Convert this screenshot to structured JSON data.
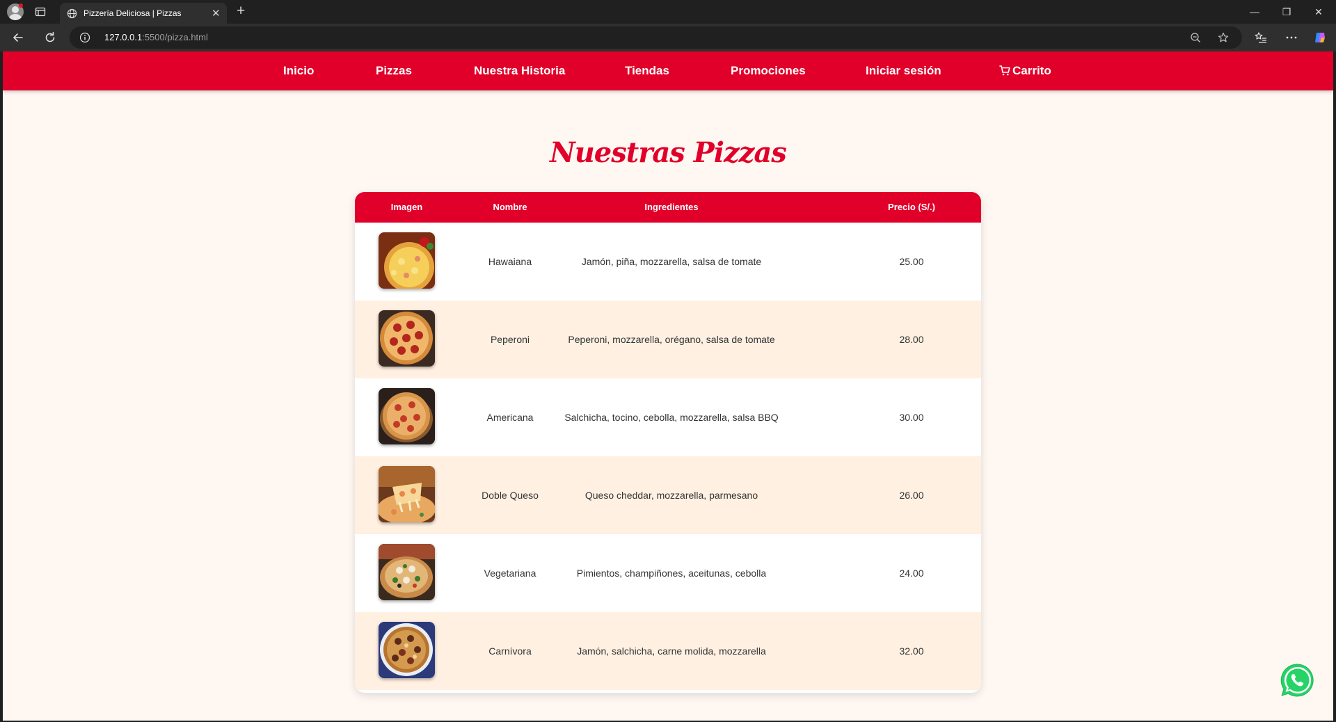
{
  "browser": {
    "tab_title": "Pizzería Deliciosa | Pizzas",
    "url_host": "127.0.0.1",
    "url_path": ":5500/pizza.html"
  },
  "nav": {
    "items": [
      {
        "label": "Inicio"
      },
      {
        "label": "Pizzas"
      },
      {
        "label": "Nuestra Historia"
      },
      {
        "label": "Tiendas"
      },
      {
        "label": "Promociones"
      },
      {
        "label": "Iniciar sesión"
      },
      {
        "label": "Carrito"
      }
    ]
  },
  "page": {
    "title": "Nuestras Pizzas"
  },
  "table": {
    "headers": [
      "Imagen",
      "Nombre",
      "Ingredientes",
      "Precio (S/.)"
    ],
    "rows": [
      {
        "name": "Hawaiana",
        "ingredients": "Jamón, piña, mozzarella, salsa de tomate",
        "price": "25.00",
        "image": "pizza-hawaiana-photo"
      },
      {
        "name": "Peperoni",
        "ingredients": "Peperoni, mozzarella, orégano, salsa de tomate",
        "price": "28.00",
        "image": "pizza-peperoni-photo"
      },
      {
        "name": "Americana",
        "ingredients": "Salchicha, tocino, cebolla, mozzarella, salsa BBQ",
        "price": "30.00",
        "image": "pizza-americana-photo"
      },
      {
        "name": "Doble Queso",
        "ingredients": "Queso cheddar, mozzarella, parmesano",
        "price": "26.00",
        "image": "pizza-doble-queso-photo"
      },
      {
        "name": "Vegetariana",
        "ingredients": "Pimientos, champiñones, aceitunas, cebolla",
        "price": "24.00",
        "image": "pizza-vegetariana-photo"
      },
      {
        "name": "Carnívora",
        "ingredients": "Jamón, salchicha, carne molida, mozzarella",
        "price": "32.00",
        "image": "pizza-carnivora-photo"
      }
    ]
  },
  "colors": {
    "brand_red": "#e1002a",
    "page_bg": "#fff7f2",
    "row_alt": "#fff0e2",
    "whatsapp_green": "#25d366"
  },
  "icons": [
    "profile-icon",
    "tabs-icon",
    "globe-icon",
    "close-icon",
    "plus-icon",
    "back-icon",
    "reload-icon",
    "info-icon",
    "zoom-icon",
    "star-icon",
    "favorites-icon",
    "more-icon",
    "copilot-icon",
    "cart-icon",
    "whatsapp-icon"
  ]
}
